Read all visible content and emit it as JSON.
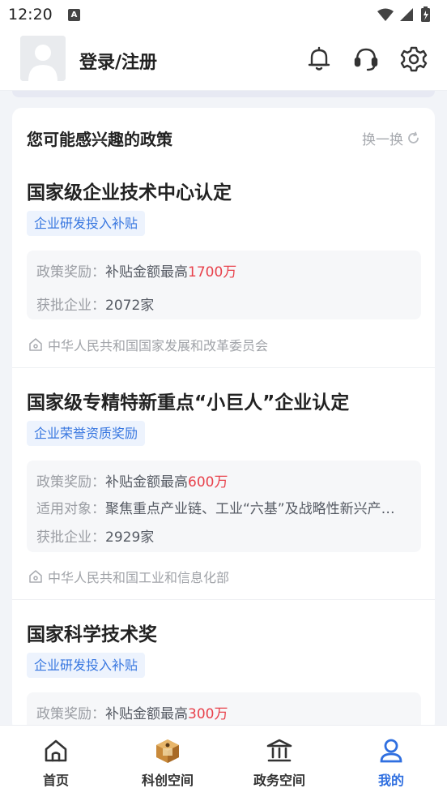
{
  "status_bar": {
    "time": "12:20"
  },
  "header": {
    "login_label": "登录/注册",
    "icons": [
      "bell-icon",
      "headset-icon",
      "gear-icon"
    ]
  },
  "section": {
    "title": "您可能感兴趣的政策",
    "refresh_label": "换一换"
  },
  "policies": [
    {
      "title": "国家级企业技术中心认定",
      "tag": "企业研发投入补贴",
      "reward_label": "政策奖励：",
      "reward_prefix": "补贴金额最高",
      "reward_amount": "1700万",
      "approved_label": "获批企业：",
      "approved_value": "2072家",
      "department": "中华人民共和国国家发展和改革委员会"
    },
    {
      "title": "国家级专精特新重点“小巨人”企业认定",
      "tag": "企业荣誉资质奖励",
      "reward_label": "政策奖励：",
      "reward_prefix": "补贴金额最高",
      "reward_amount": "600万",
      "target_label": "适用对象：",
      "target_value": "聚焦重点产业链、工业“六基”及战略性新兴产业领域的专精特新企业",
      "approved_label": "获批企业：",
      "approved_value": "2929家",
      "department": "中华人民共和国工业和信息化部"
    },
    {
      "title": "国家科学技术奖",
      "tag": "企业研发投入补贴",
      "reward_label": "政策奖励：",
      "reward_prefix": "补贴金额最高",
      "reward_amount": "300万"
    }
  ],
  "tabs": [
    {
      "label": "首页",
      "icon": "home-icon",
      "active": false
    },
    {
      "label": "科创空间",
      "icon": "innovation-space-icon",
      "active": false
    },
    {
      "label": "政务空间",
      "icon": "government-building-icon",
      "active": false
    },
    {
      "label": "我的",
      "icon": "profile-icon",
      "active": true
    }
  ],
  "colors": {
    "accent": "#2f6fe0",
    "tag_bg": "#edf3fd",
    "tag_text": "#3877e0",
    "highlight_red": "#e8414b",
    "page_bg": "#f2f4f8"
  }
}
